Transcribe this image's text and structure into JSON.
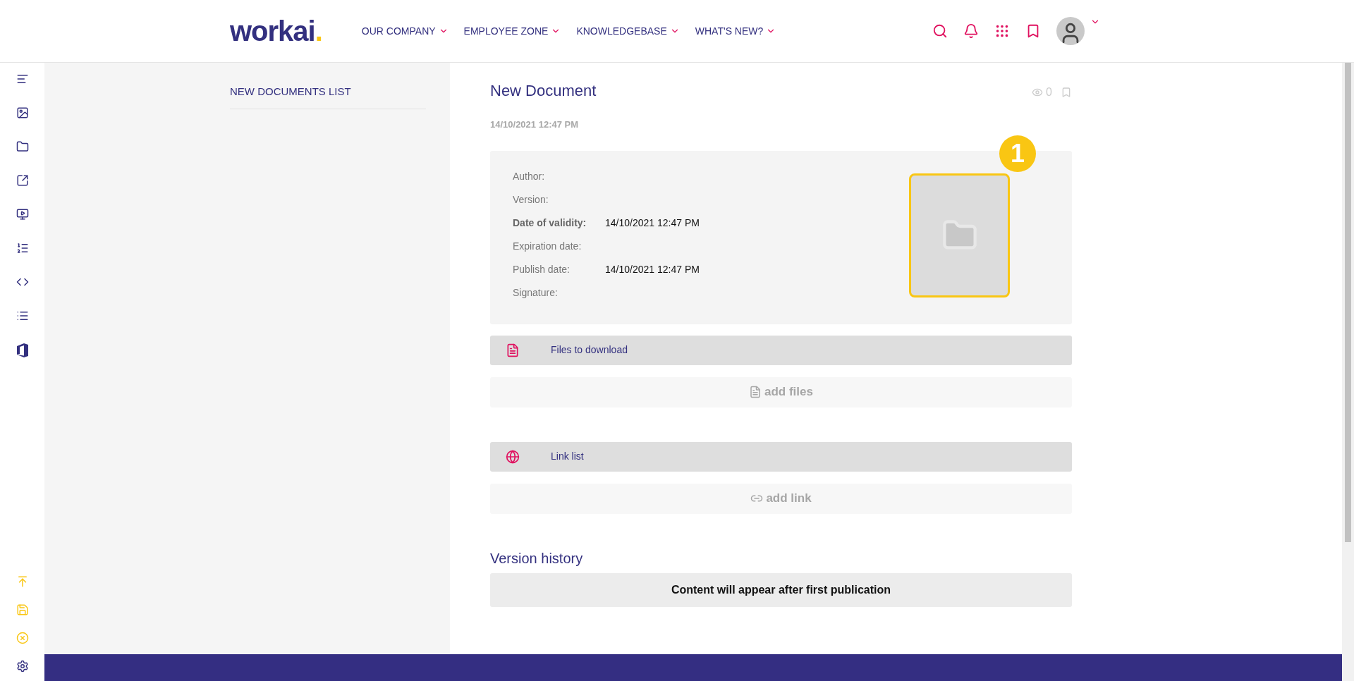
{
  "header": {
    "logo": {
      "text": "workai",
      "dot": "."
    },
    "nav": [
      {
        "label": "OUR COMPANY"
      },
      {
        "label": "EMPLOYEE ZONE"
      },
      {
        "label": "KNOWLEDGEBASE"
      },
      {
        "label": "WHAT'S NEW?"
      }
    ]
  },
  "sidebar": {
    "tools": [
      {
        "kind": "text"
      },
      {
        "kind": "image"
      },
      {
        "kind": "folder"
      },
      {
        "kind": "external"
      },
      {
        "kind": "video"
      },
      {
        "kind": "table"
      },
      {
        "kind": "code"
      },
      {
        "kind": "list"
      },
      {
        "kind": "office"
      }
    ],
    "actions": [
      {
        "kind": "publish"
      },
      {
        "kind": "save"
      },
      {
        "kind": "cancel"
      },
      {
        "kind": "settings"
      }
    ]
  },
  "left_panel": {
    "title": "NEW DOCUMENTS LIST"
  },
  "document": {
    "title": "New Document",
    "views": "0",
    "date": "14/10/2021 12:47 PM",
    "fields": [
      {
        "label": "Author:",
        "bold": false
      },
      {
        "label": "Version:",
        "bold": false
      },
      {
        "label": "Date of validity:",
        "value": "14/10/2021 12:47 PM",
        "bold": true
      },
      {
        "label": "Expiration date:",
        "bold": false
      },
      {
        "label": "Publish date:",
        "value": "14/10/2021 12:47 PM",
        "bold": false
      },
      {
        "label": "Signature:",
        "bold": false
      }
    ],
    "step_badge": "1",
    "sections": [
      {
        "kind": "files",
        "title": "Files to download",
        "add": "add files"
      },
      {
        "kind": "links",
        "title": "Link list",
        "add": "add link"
      }
    ],
    "history": {
      "title": "Version history",
      "message": "Content will appear after first publication"
    }
  }
}
